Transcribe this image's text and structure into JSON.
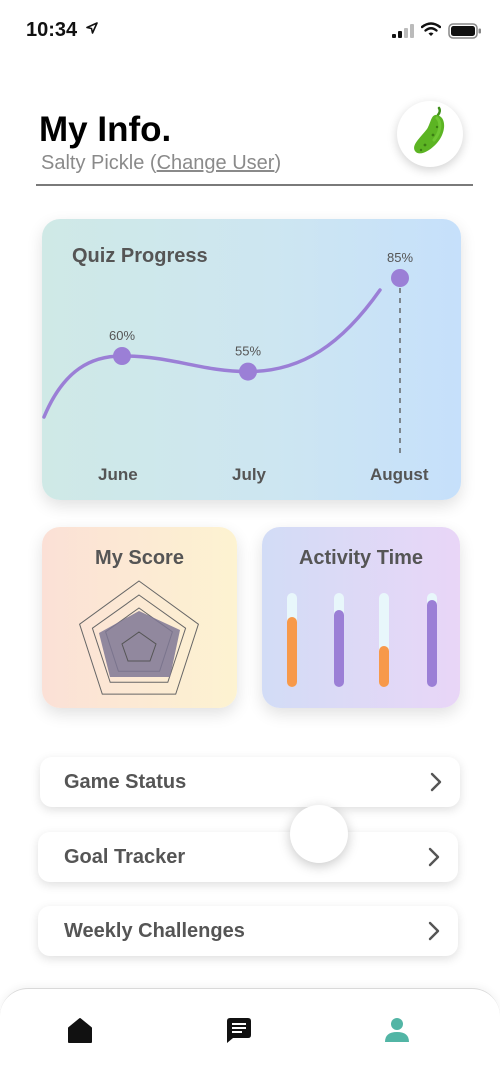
{
  "status_bar": {
    "time": "10:34"
  },
  "header": {
    "title": "My Info.",
    "user_name": "Salty Pickle (",
    "change_user": "Change User",
    "user_close": ")"
  },
  "quiz_card": {
    "title": "Quiz Progress",
    "chart_data": {
      "type": "line",
      "title": "Quiz Progress",
      "categories": [
        "June",
        "July",
        "August"
      ],
      "values": [
        60,
        55,
        85
      ],
      "value_labels": [
        "60%",
        "55%",
        "85%"
      ],
      "color": "#9b7fd6"
    }
  },
  "score_card": {
    "title": "My Score"
  },
  "activity_card": {
    "title": "Activity Time",
    "bars": [
      {
        "value": 0.74,
        "color": "#f7994a"
      },
      {
        "value": 0.82,
        "color": "#9b7fd6"
      },
      {
        "value": 0.44,
        "color": "#f7994a"
      },
      {
        "value": 0.93,
        "color": "#9b7fd6"
      }
    ]
  },
  "menu": {
    "items": [
      {
        "label": "Game Status"
      },
      {
        "label": "Goal Tracker"
      },
      {
        "label": "Weekly Challenges"
      }
    ]
  },
  "tab_bar": {
    "icons": [
      "home-icon",
      "chat-icon",
      "profile-icon"
    ],
    "active_color": "#52b5a5"
  }
}
